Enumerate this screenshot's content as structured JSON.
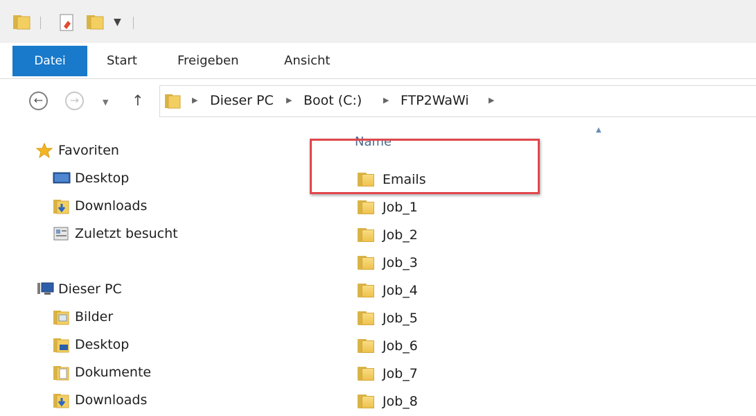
{
  "ribbon": {
    "tabs": [
      "Datei",
      "Start",
      "Freigeben",
      "Ansicht"
    ]
  },
  "address": {
    "crumbs": [
      "Dieser PC",
      "Boot (C:)",
      "FTP2WaWi"
    ]
  },
  "navpane": {
    "favorites_label": "Favoriten",
    "favorites": [
      "Desktop",
      "Downloads",
      "Zuletzt besucht"
    ],
    "pc_label": "Dieser PC",
    "pc_items": [
      "Bilder",
      "Desktop",
      "Dokumente",
      "Downloads"
    ]
  },
  "filelist": {
    "column_name": "Name",
    "items": [
      "Emails",
      "Job_1",
      "Job_2",
      "Job_3",
      "Job_4",
      "Job_5",
      "Job_6",
      "Job_7",
      "Job_8"
    ]
  },
  "colors": {
    "file_tab": "#1979ca",
    "highlight": "#e0474c",
    "folder": "#efc24f"
  }
}
